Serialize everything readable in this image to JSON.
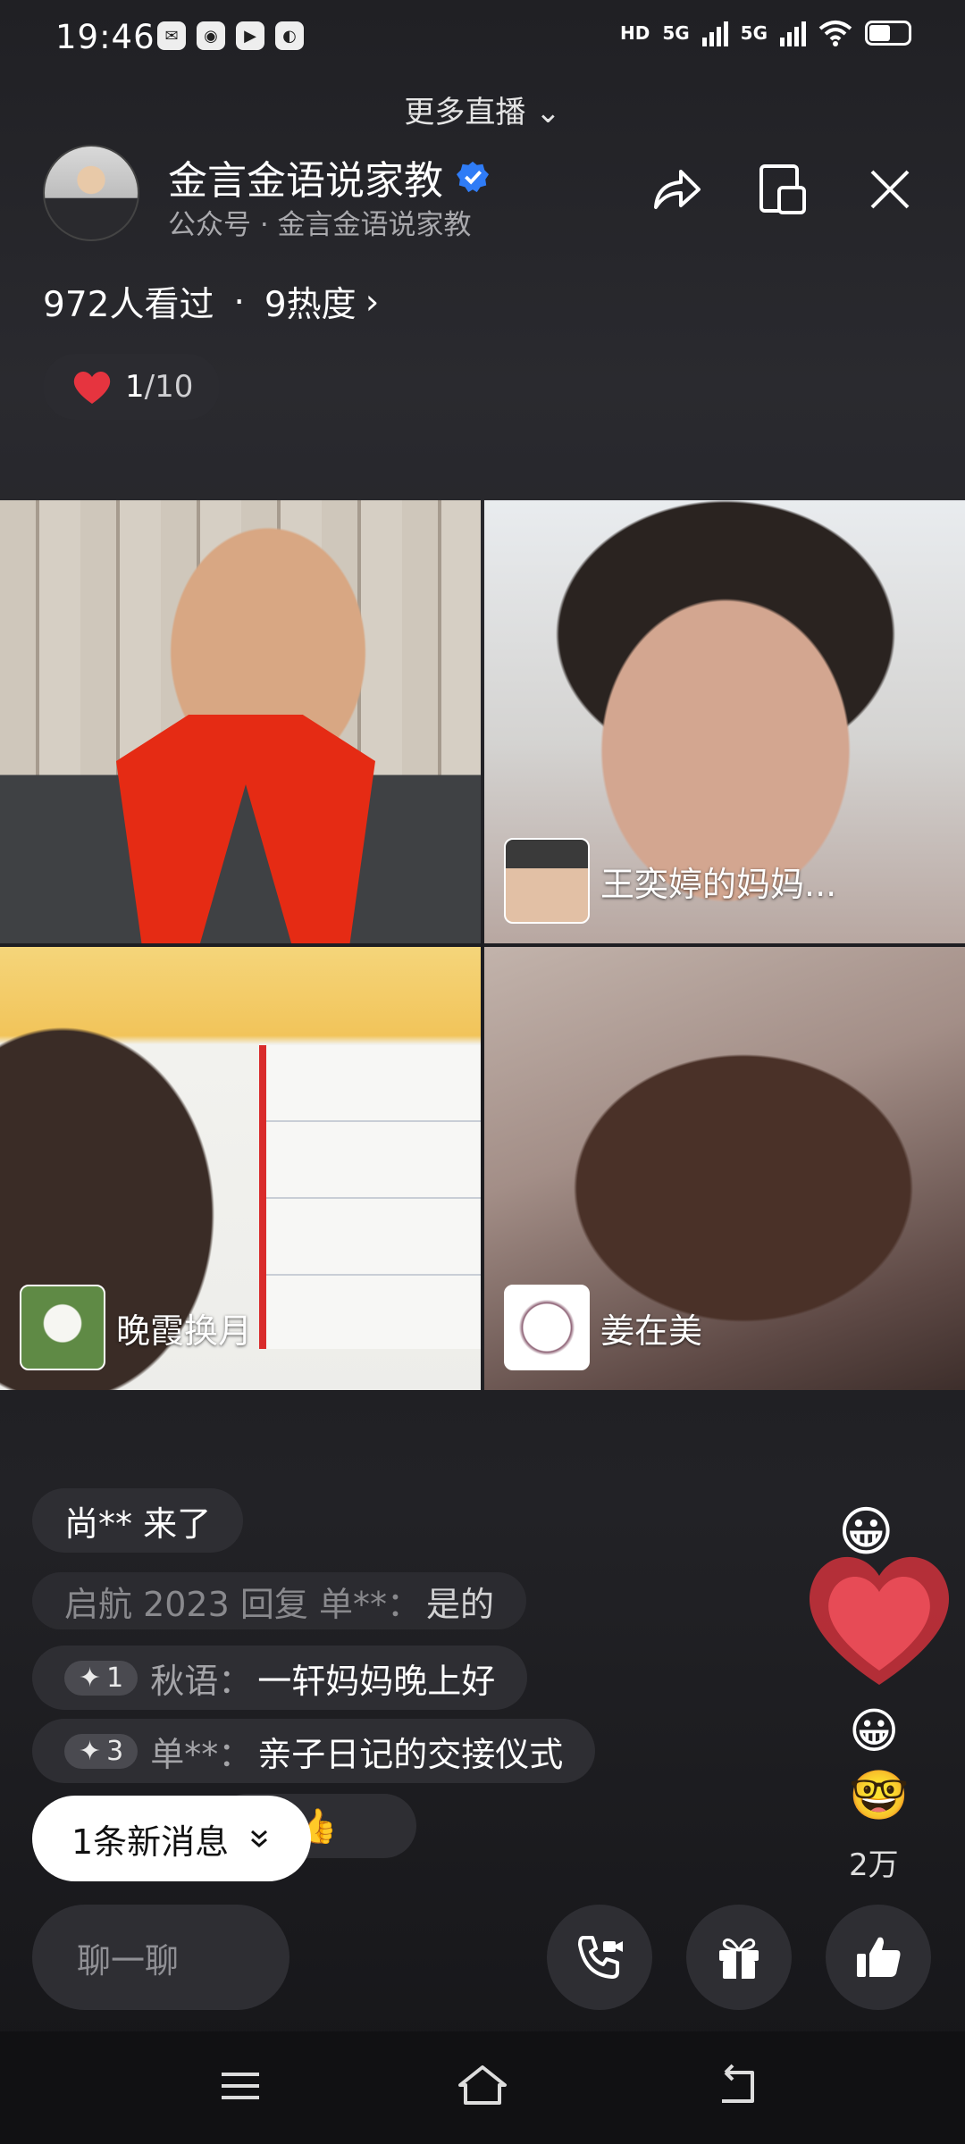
{
  "status_bar": {
    "time": "19:46",
    "network_label": "HD",
    "signal_1": "5G",
    "signal_2": "5G"
  },
  "header": {
    "more_live": "更多直播",
    "title": "金言金语说家教",
    "subtitle": "公众号 · 金言金语说家教",
    "viewers": "972人看过",
    "heat": "9热度",
    "like_count": "1",
    "like_total": "/10"
  },
  "icons": {
    "share": "share-icon",
    "pip": "picture-in-picture-icon",
    "close": "close-icon",
    "verified": "verified-icon"
  },
  "tiles": [
    {
      "name": ""
    },
    {
      "name": "王奕婷的妈妈..."
    },
    {
      "name": "晚霞换月"
    },
    {
      "name": "姜在美"
    }
  ],
  "chat": {
    "join": "尚** 来了",
    "msg1_name": "启航 2023 回复 单**：",
    "msg1_text": "是的",
    "msg2_badge": "1",
    "msg2_name": "秋语：",
    "msg2_text": "一轩妈妈晚上好",
    "msg3_badge": "3",
    "msg3_name": "单**：",
    "msg3_text": "亲子日记的交接仪式",
    "new_messages": "1条新消息"
  },
  "side": {
    "likes_total": "2万"
  },
  "bottom": {
    "chat_placeholder": "聊一聊"
  },
  "colors": {
    "accent_heart": "#e6343f",
    "verified_blue": "#2f7cf6",
    "scarf_red": "#e52b14"
  }
}
